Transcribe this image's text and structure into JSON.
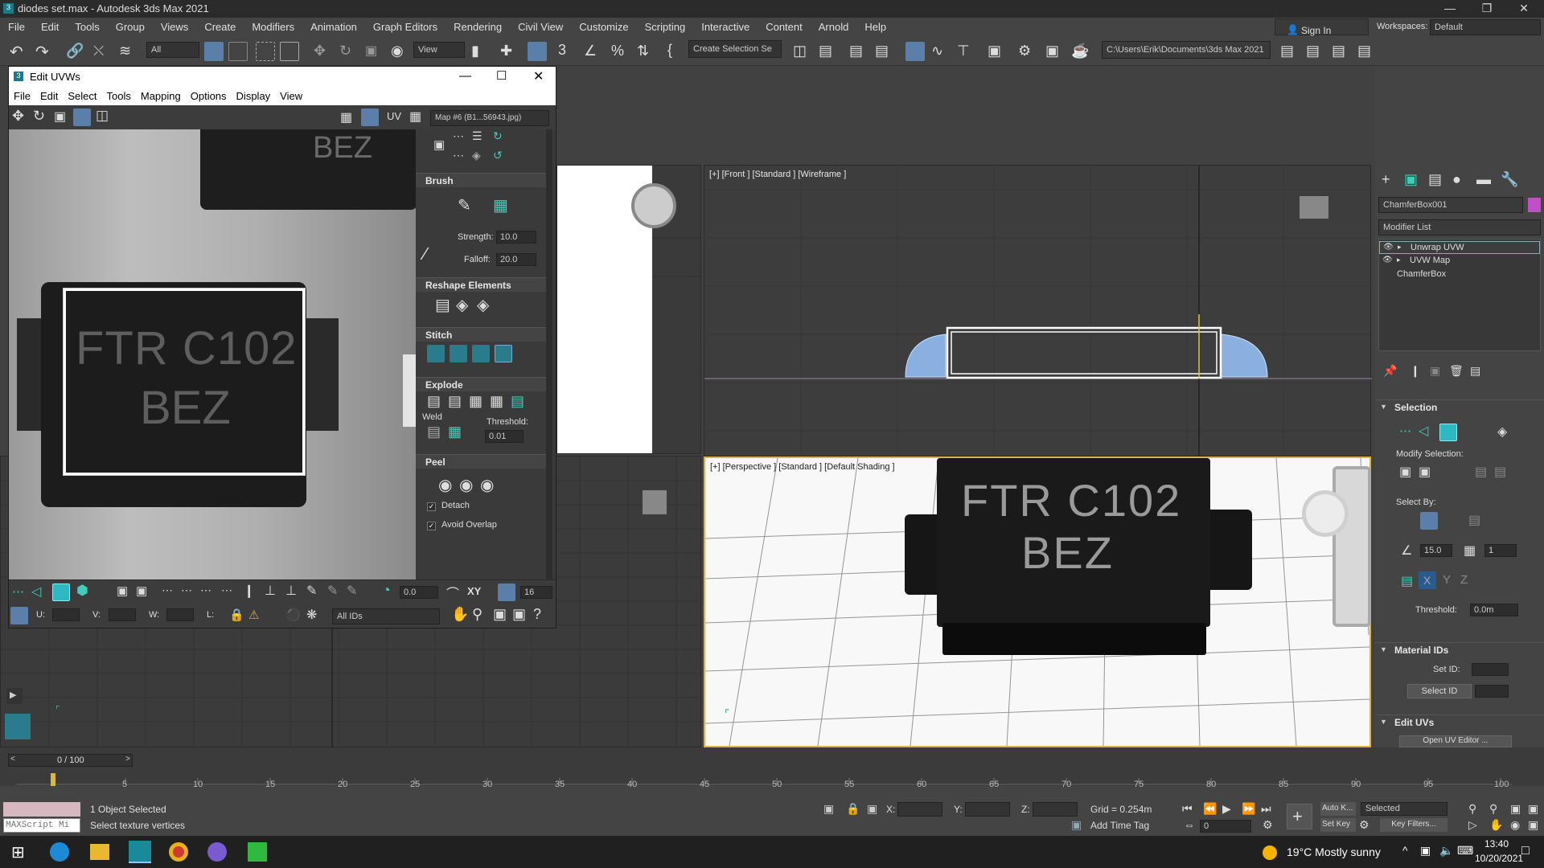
{
  "window": {
    "title": "diodes set.max - Autodesk 3ds Max 2021"
  },
  "menu": [
    "File",
    "Edit",
    "Tools",
    "Group",
    "Views",
    "Create",
    "Modifiers",
    "Animation",
    "Graph Editors",
    "Rendering",
    "Civil View",
    "Customize",
    "Scripting",
    "Interactive",
    "Content",
    "Arnold",
    "Help"
  ],
  "account": {
    "sign_in": "Sign In",
    "workspaces_label": "Workspaces:",
    "workspace": "Default"
  },
  "toolbar": {
    "filter": "All",
    "view": "View",
    "selection_set": "Create Selection Se",
    "path": "C:\\Users\\Erik\\Documents\\3ds Max 2021"
  },
  "uv_editor": {
    "title": "Edit UVWs",
    "menu": [
      "File",
      "Edit",
      "Select",
      "Tools",
      "Mapping",
      "Options",
      "Display",
      "View"
    ],
    "uv_label": "UV",
    "map_dropdown": "Map #6 (B1...56943.jpg)",
    "texture_text": {
      "line1": "FTR C102",
      "line2": "BEZ",
      "top_partial": "BEZ"
    },
    "brush": {
      "header": "Brush",
      "strength_label": "Strength:",
      "strength": "10.0",
      "falloff_label": "Falloff:",
      "falloff": "20.0"
    },
    "reshape": {
      "header": "Reshape Elements"
    },
    "stitch": {
      "header": "Stitch"
    },
    "explode": {
      "header": "Explode",
      "weld_label": "Weld",
      "threshold_label": "Threshold:",
      "threshold": "0.01"
    },
    "peel": {
      "header": "Peel",
      "detach_label": "Detach",
      "avoid_overlap_label": "Avoid Overlap",
      "detach_checked": "✓",
      "avoid_checked": "✓"
    },
    "bottom": {
      "rotate_value": "0.0",
      "xy_label": "XY",
      "grid_value": "16",
      "u_label": "U:",
      "v_label": "V:",
      "w_label": "W:",
      "l_label": "L:",
      "ids": "All IDs"
    }
  },
  "viewports": {
    "front": {
      "label": "[+] [Front ] [Standard ] [Wireframe ]"
    },
    "perspective": {
      "label": "[+] [Perspective ] [Standard ] [Default Shading ]",
      "chip_line1": "FTR C102",
      "chip_line2": "BEZ"
    }
  },
  "command_panel": {
    "object_name": "ChamferBox001",
    "modifier_list_label": "Modifier List",
    "stack": [
      "Unwrap UVW",
      "UVW Map",
      "ChamferBox"
    ],
    "selection": {
      "header": "Selection",
      "modify_selection": "Modify Selection:",
      "select_by": "Select By:",
      "angle": "15.0",
      "count": "1",
      "threshold_label": "Threshold:",
      "threshold": "0.0m",
      "x": "X",
      "y": "Y",
      "z": "Z"
    },
    "material_ids": {
      "header": "Material IDs",
      "set_id": "Set ID:",
      "select_id": "Select ID"
    },
    "edit_uvs": {
      "header": "Edit UVs",
      "open_editor": "Open UV Editor ..."
    }
  },
  "timeline": {
    "frame": "0 / 100",
    "ticks": [
      "5",
      "10",
      "15",
      "20",
      "25",
      "30",
      "35",
      "40",
      "45",
      "50",
      "55",
      "60",
      "65",
      "70",
      "75",
      "80",
      "85",
      "90",
      "95",
      "100"
    ]
  },
  "status": {
    "script_placeholder": "MAXScript Mi",
    "selected": "1 Object Selected",
    "prompt": "Select texture vertices",
    "x_label": "X:",
    "y_label": "Y:",
    "z_label": "Z:",
    "grid": "Grid = 0.254m",
    "add_time_tag": "Add Time Tag",
    "auto_key": "Auto K...",
    "set_key": "Set Key",
    "key_mode": "Selected",
    "key_filters": "Key Filters...",
    "frame_value": "0"
  },
  "taskbar": {
    "weather": "19°C  Mostly sunny",
    "time": "13:40",
    "date": "10/20/2021"
  }
}
